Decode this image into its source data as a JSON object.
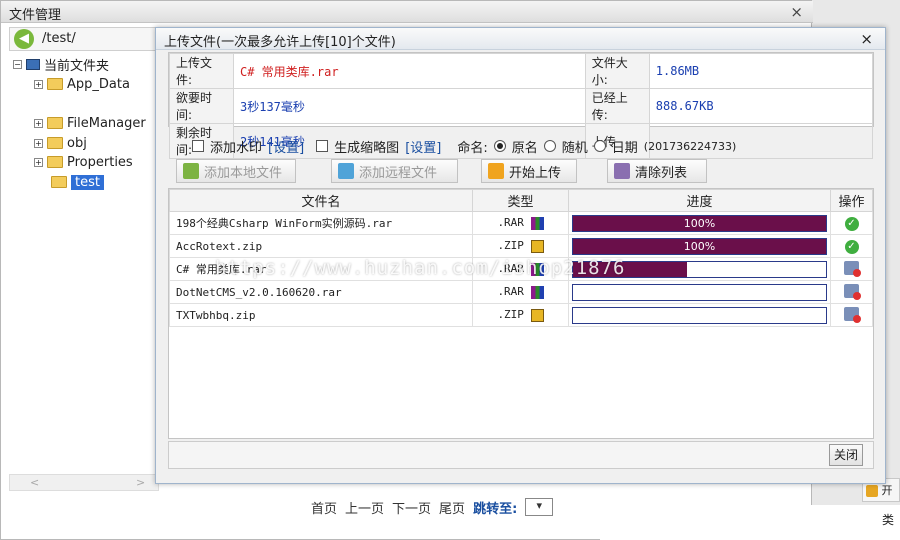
{
  "file_manager": {
    "title": "文件管理",
    "close": "×",
    "path": "/test/",
    "tree": {
      "root": "当前文件夹",
      "folders": [
        "App_Data",
        "FileManager",
        "obj",
        "Properties",
        "test"
      ],
      "selected": "test"
    },
    "pager": {
      "first": "首页",
      "prev": "上一页",
      "next": "下一页",
      "last": "尾页",
      "jump": "跳转至:",
      "select_value": "▾"
    },
    "fragments": {
      "btn": "开",
      "col": "类"
    }
  },
  "upload_dialog": {
    "title": "上传文件(一次最多允许上传[10]个文件)",
    "close": "×",
    "info": {
      "upload_file_label": "上传文件:",
      "upload_file_value": "C# 常用类库.rar",
      "file_size_label": "文件大小:",
      "file_size_value": "1.86MB",
      "elapsed_label": "欲要时间:",
      "elapsed_value": "3秒137毫秒",
      "uploaded_label": "已经上传:",
      "uploaded_value": "888.67KB",
      "remaining_label": "剩余时间:",
      "remaining_value": "2秒141毫秒",
      "speed_label": "上传"
    },
    "options": {
      "watermark": "添加水印",
      "watermark_set": "[设置]",
      "thumbnail": "生成缩略图",
      "thumbnail_set": "[设置]",
      "naming_label": "命名:",
      "name_original": "原名",
      "name_random": "随机",
      "name_date": "日期",
      "date_sample": "(201736224733)"
    },
    "toolbar": {
      "add_local": "添加本地文件",
      "add_remote": "添加远程文件",
      "start_upload": "开始上传",
      "clear_list": "清除列表"
    },
    "columns": [
      "文件名",
      "类型",
      "进度",
      "操作"
    ],
    "files": [
      {
        "name": "198个经典Csharp WinForm实例源码.rar",
        "type": ".RAR",
        "progress": 100,
        "progress_text": "100%",
        "status": "done"
      },
      {
        "name": "AccRotext.zip",
        "type": ".ZIP",
        "progress": 100,
        "progress_text": "100%",
        "status": "done"
      },
      {
        "name": "C# 常用类库.rar",
        "type": ".RAR",
        "progress": 45,
        "progress_text": "",
        "status": "pending"
      },
      {
        "name": "DotNetCMS_v2.0.160620.rar",
        "type": ".RAR",
        "progress": 0,
        "progress_text": "",
        "status": "pending"
      },
      {
        "name": "TXTwbhbq.zip",
        "type": ".ZIP",
        "progress": 0,
        "progress_text": "",
        "status": "pending"
      }
    ],
    "close_button": "关闭"
  },
  "watermark_text": "https://www.huzhan.com/ishop21876",
  "colors": {
    "progress_fill": "#6a0f4a",
    "accent": "#1a4fa0"
  }
}
